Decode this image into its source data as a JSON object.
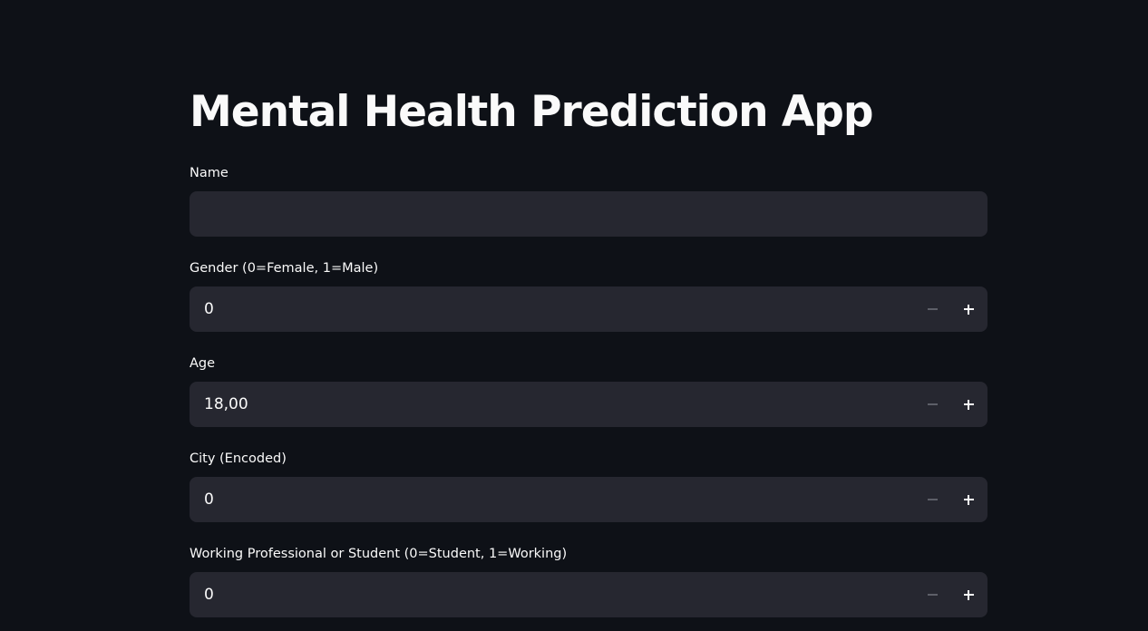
{
  "app": {
    "title": "Mental Health Prediction App"
  },
  "fields": [
    {
      "label": "Name",
      "type": "text",
      "value": ""
    },
    {
      "label": "Gender (0=Female, 1=Male)",
      "type": "number",
      "value": "0"
    },
    {
      "label": "Age",
      "type": "number",
      "value": "18,00"
    },
    {
      "label": "City (Encoded)",
      "type": "number",
      "value": "0"
    },
    {
      "label": "Working Professional or Student (0=Student, 1=Working)",
      "type": "number",
      "value": "0"
    }
  ],
  "icons": {
    "decrement": "minus-icon",
    "increment": "plus-icon"
  },
  "colors": {
    "background": "#0e1117",
    "input_background": "#262730",
    "text": "#fafafa",
    "muted_icon": "#5d5f68"
  }
}
